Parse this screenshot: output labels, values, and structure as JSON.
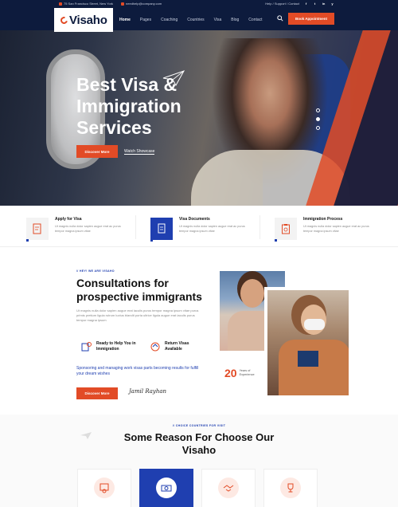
{
  "topbar": {
    "address": "75 San Francisco Street, New York",
    "email": "needhelp@company.com",
    "links": "Help / Support / Contact",
    "social": [
      "f",
      "t",
      "in",
      "y"
    ]
  },
  "header": {
    "logo": "Visaho",
    "nav": [
      "Home",
      "Pages",
      "Coaching",
      "Countries",
      "Visa",
      "Blog",
      "Contact"
    ],
    "appointment_btn": "Book Appointment"
  },
  "hero": {
    "title": "Best Visa & Immigration Services",
    "discover_btn": "Discover More",
    "watch_link": "Watch Showcase",
    "slides": 3,
    "active_slide": 1
  },
  "services": [
    {
      "title": "Apply for Visa",
      "text": "Ut magnis nulla dolor sapien augue erat ac purus tempor magna ipsum vitae",
      "icon": "document-pen-icon"
    },
    {
      "title": "Visa Documents",
      "text": "Ut magnis nulla dolor sapien augue erat ac purus tempor magna ipsum vitae",
      "icon": "documents-icon"
    },
    {
      "title": "Immigration Process",
      "text": "Ut magnis nulla dolor sapien augue erat ac purus tempor magna ipsum vitae",
      "icon": "clipboard-icon"
    }
  ],
  "about": {
    "kicker": "// HEY! WE ARE VISAHO",
    "title": "Consultations for prospective immigrants",
    "text": "Ut magnis nulla dolor sapien augue erat iaculis purus tempor magna ipsum vitae purus primis pretium ligula rutrum luctus blandit porta ultrice ligula augue erat iaculis purus tempor magna ipsum",
    "features": [
      {
        "label": "Ready to Help You in Immigration",
        "icon": "hands-help-icon"
      },
      {
        "label": "Return Visas Available",
        "icon": "return-visa-icon"
      }
    ],
    "highlight": "Sponsoring and managing work visas parts becoming results for fulfill your dream wishes",
    "button": "Discover More",
    "signature": "Jamil Rayhan",
    "experience_number": "20",
    "experience_label": "Years of Experience"
  },
  "reasons": {
    "kicker": "// CHOICE COUNTRIES FOR VISIT",
    "title": "Some Reason For Choose Our Visaho",
    "cards": [
      {
        "icon": "certificate-icon",
        "active": false
      },
      {
        "icon": "money-icon",
        "active": true
      },
      {
        "icon": "handshake-icon",
        "active": false
      },
      {
        "icon": "trophy-icon",
        "active": false
      }
    ]
  },
  "colors": {
    "navy": "#0d1b3d",
    "accent": "#e24b26",
    "blue": "#1f3fb0"
  }
}
